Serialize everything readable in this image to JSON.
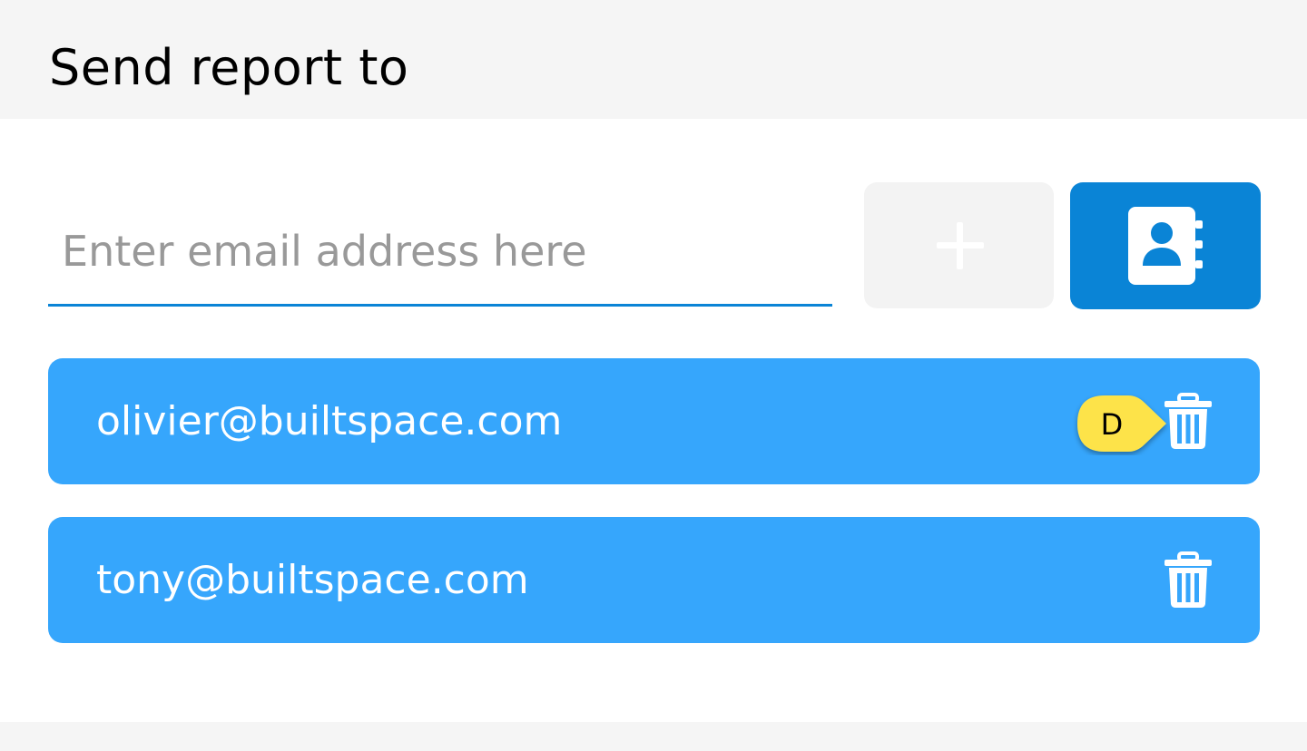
{
  "header": {
    "title": "Send report to"
  },
  "input": {
    "placeholder": "Enter email address here",
    "value": ""
  },
  "buttons": {
    "add_icon": "plus-icon",
    "contacts_icon": "contact-book-icon"
  },
  "recipients": [
    {
      "email": "olivier@builtspace.com",
      "delete_icon": "trash-icon"
    },
    {
      "email": "tony@builtspace.com",
      "delete_icon": "trash-icon"
    }
  ],
  "annotation": {
    "label": "D"
  },
  "colors": {
    "accent": "#0a84d6",
    "recipient_bg": "#36a6fc",
    "header_bg": "#f5f5f5",
    "disabled_button": "#f3f3f3",
    "callout": "#fde34a"
  }
}
